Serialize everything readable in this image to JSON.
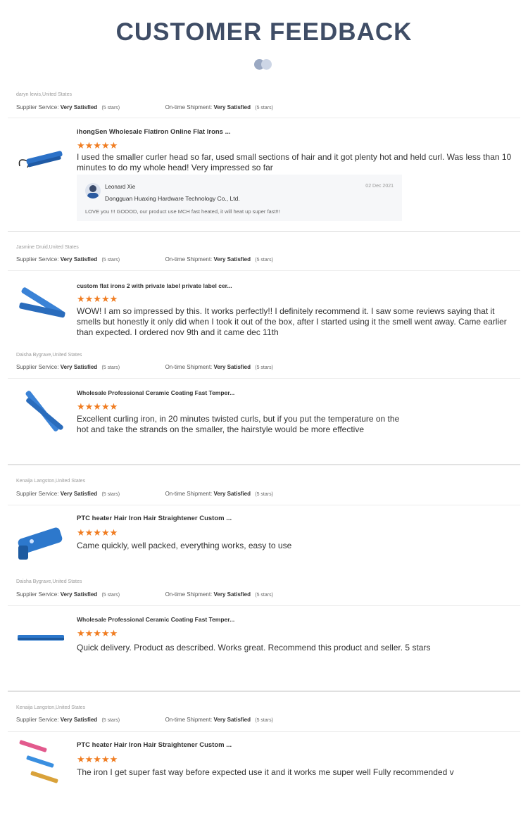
{
  "header": {
    "title": "CUSTOMER FEEDBACK"
  },
  "labels": {
    "supplier": "Supplier Service:",
    "shipment": "On-time Shipment:",
    "satisfied": "Very Satisfied",
    "five_stars": "(5 stars)"
  },
  "stars_text": "★★★★★",
  "rating_color": "#f07d22",
  "reviews": [
    {
      "user": "daryn lewis,United States",
      "product": "ihongSen Wholesale Flatiron Online Flat Irons ...",
      "rating": 5,
      "text": "I used the smaller curler head so far, used small sections of hair and it got plenty hot and held curl. Was less than 10 minutes to do my whole head! Very impressed so far",
      "reply": {
        "name": "Leonard Xie",
        "company": "Dongguan Huaxing Hardware Technology Co., Ltd.",
        "date": "02 Dec 2021",
        "message": "LOVE you !!! GOOOD, our product use MCH fast heated, it will heat up super fast!!!"
      }
    },
    {
      "user": "Jasmine Druid,United States",
      "product": "custom flat irons 2 with private label private label cer...",
      "rating": 5,
      "text": "WOW! I am so impressed by this. It works perfectly!! I definitely recommend it. I saw some reviews saying that it smells but honestly it only did when I took it out of the box, after I started using it the smell went away. Came earlier than expected. I ordered nov 9th and it came dec 11th"
    },
    {
      "user": "Daisha Bygrave,United States",
      "product": "Wholesale Professional Ceramic Coating Fast Temper...",
      "rating": 5,
      "text": "Excellent curling iron, in 20 minutes twisted curls, but if you put the temperature on the hot and take the strands on the smaller, the hairstyle would be more effective"
    },
    {
      "user": "Kenaija Langston,United States",
      "product": "PTC heater Hair Iron Hair Straightener Custom ...",
      "rating": 5,
      "text": "Came quickly, well packed, everything works, easy to use"
    },
    {
      "user": "Daisha Bygrave,United States",
      "product": "Wholesale Professional Ceramic Coating Fast Temper...",
      "rating": 5,
      "text": "Quick delivery. Product as described. Works great. Recommend this product and seller. 5 stars"
    },
    {
      "user": "Kenaija Langston,United States",
      "product": "PTC heater Hair Iron Hair Straightener Custom ...",
      "rating": 5,
      "text": "The iron I get super fast way before expected use it and it works me super well Fully recommended v"
    }
  ]
}
